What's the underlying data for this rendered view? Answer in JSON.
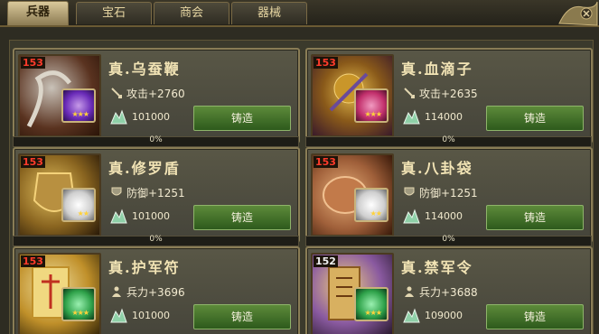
{
  "tabs": [
    {
      "label": "兵器",
      "active": true
    },
    {
      "label": "宝石",
      "active": false
    },
    {
      "label": "商会",
      "active": false
    },
    {
      "label": "器械",
      "active": false
    }
  ],
  "items": [
    {
      "level": "153",
      "name": "真.乌蚕鞭",
      "stat_icon": "attack-icon",
      "stat": "攻击+2760",
      "cost": "101000",
      "forge_label": "铸造",
      "progress_label": "0%",
      "progress_fraction": 0,
      "gem_color": "#6a2bb8",
      "stars": "★★★"
    },
    {
      "level": "153",
      "name": "真.血滴子",
      "stat_icon": "attack-icon",
      "stat": "攻击+2635",
      "cost": "114000",
      "forge_label": "铸造",
      "progress_label": "0%",
      "progress_fraction": 0,
      "gem_color": "#c2306c",
      "stars": "★★★"
    },
    {
      "level": "153",
      "name": "真.修罗盾",
      "stat_icon": "defense-icon",
      "stat": "防御+1251",
      "cost": "101000",
      "forge_label": "铸造",
      "progress_label": "0%",
      "progress_fraction": 0,
      "gem_color": "#d9d9d9",
      "stars": "★★"
    },
    {
      "level": "153",
      "name": "真.八卦袋",
      "stat_icon": "defense-icon",
      "stat": "防御+1251",
      "cost": "114000",
      "forge_label": "铸造",
      "progress_label": "0%",
      "progress_fraction": 0,
      "gem_color": "#d9d9d9",
      "stars": "★★"
    },
    {
      "level": "153",
      "name": "真.护军符",
      "stat_icon": "troops-icon",
      "stat": "兵力+3696",
      "cost": "101000",
      "forge_label": "铸造",
      "progress_label": "",
      "progress_fraction": 0,
      "gem_color": "#2fa24a",
      "stars": "★★★"
    },
    {
      "level": "152",
      "name": "真.禁军令",
      "stat_icon": "troops-icon",
      "stat": "兵力+3688",
      "cost": "109000",
      "forge_label": "铸造",
      "progress_label": "",
      "progress_fraction": 0,
      "gem_color": "#2fa24a",
      "stars": "★★★"
    }
  ],
  "theme": {
    "accent": "#6b5a33",
    "button_green": "#3e7a2a",
    "level_red": "#ff3b2b"
  }
}
